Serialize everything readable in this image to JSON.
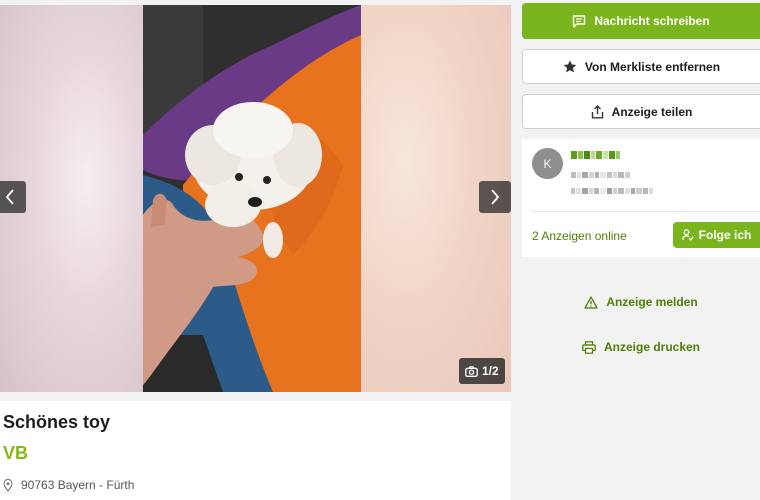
{
  "gallery": {
    "counter": "1/2",
    "prev_label": "Vorheriges Bild",
    "next_label": "Nächstes Bild"
  },
  "listing": {
    "title": "Schönes toy",
    "price": "VB",
    "location": "90763 Bayern - Fürth"
  },
  "actions": {
    "message": "Nachricht schreiben",
    "watchlist": "Von Merkliste entfernen",
    "share": "Anzeige teilen",
    "report": "Anzeige melden",
    "print": "Anzeige drucken"
  },
  "seller": {
    "avatar_initial": "K",
    "ads_online": "2 Anzeigen online",
    "follow": "Folge ich"
  },
  "colors": {
    "accent": "#7ab51d",
    "link": "#4e7f06",
    "price": "#86b817"
  }
}
